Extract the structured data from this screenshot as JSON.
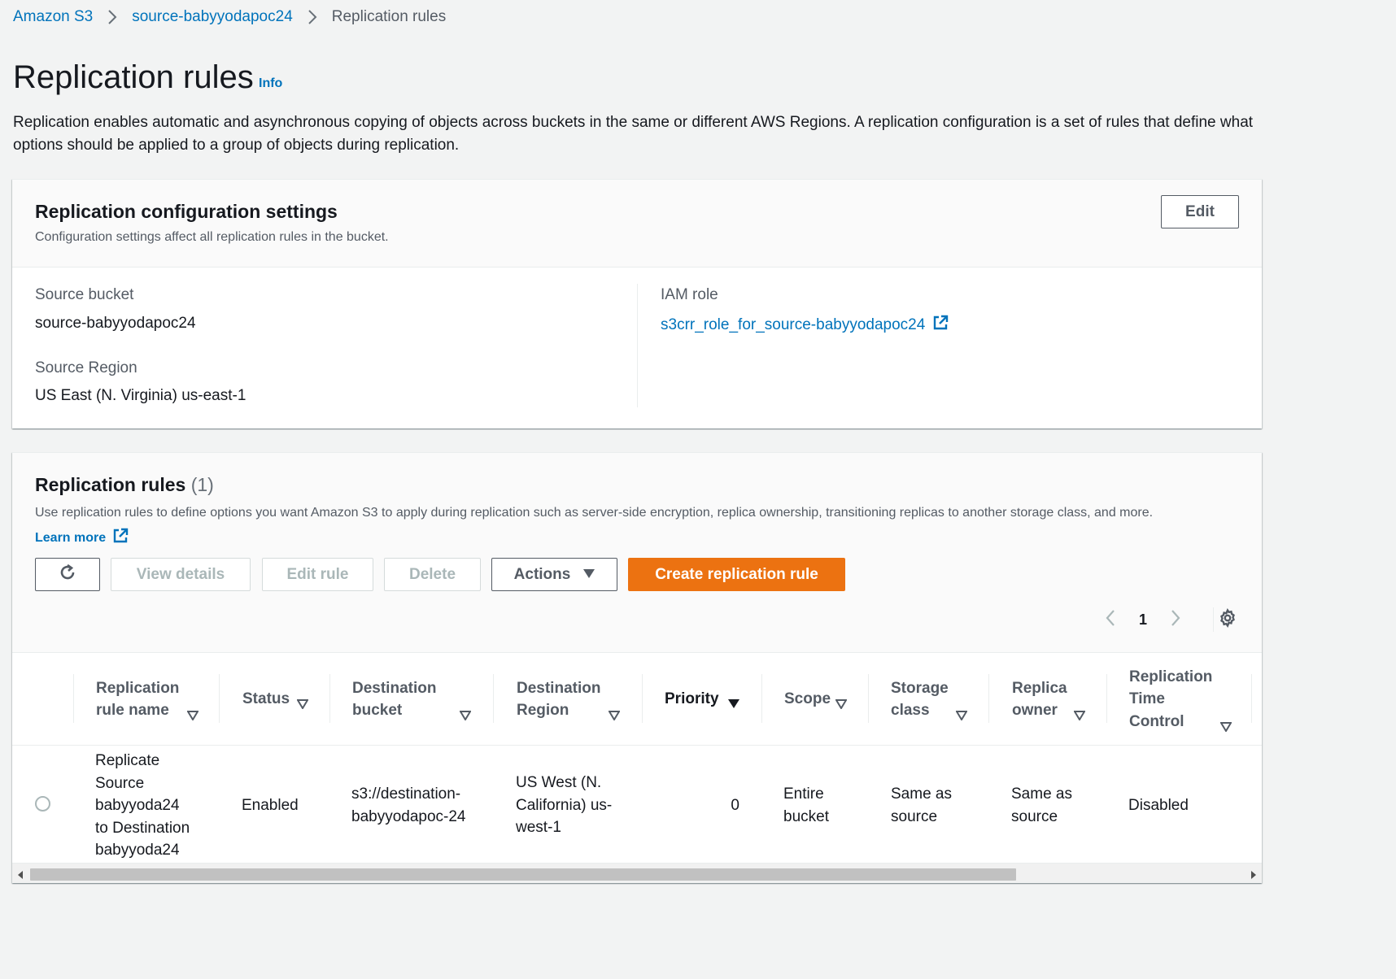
{
  "breadcrumb": {
    "items": [
      "Amazon S3",
      "source-babyyodapoc24"
    ],
    "current": "Replication rules"
  },
  "page": {
    "title": "Replication rules",
    "info": "Info",
    "description": "Replication enables automatic and asynchronous copying of objects across buckets in the same or different AWS Regions. A replication configuration is a set of rules that define what options should be applied to a group of objects during replication."
  },
  "config": {
    "title": "Replication configuration settings",
    "subtitle": "Configuration settings affect all replication rules in the bucket.",
    "edit_label": "Edit",
    "source_bucket_label": "Source bucket",
    "source_bucket_value": "source-babyyodapoc24",
    "source_region_label": "Source Region",
    "source_region_value": "US East (N. Virginia) us-east-1",
    "iam_role_label": "IAM role",
    "iam_role_value": "s3crr_role_for_source-babyyodapoc24"
  },
  "rules": {
    "title": "Replication rules",
    "count": "(1)",
    "description": "Use replication rules to define options you want Amazon S3 to apply during replication such as server-side encryption, replica ownership, transitioning replicas to another storage class, and more.",
    "learn_more": "Learn more",
    "buttons": {
      "view_details": "View details",
      "edit_rule": "Edit rule",
      "delete": "Delete",
      "actions": "Actions",
      "create": "Create replication rule"
    },
    "page_number": "1",
    "columns": {
      "name": [
        "Replication",
        "rule name"
      ],
      "status": "Status",
      "destination_bucket": [
        "Destination",
        "bucket"
      ],
      "destination_region": [
        "Destination",
        "Region"
      ],
      "priority": "Priority",
      "scope": "Scope",
      "storage_class": [
        "Storage",
        "class"
      ],
      "replica_owner": [
        "Replica",
        "owner"
      ],
      "rtc": [
        "Replication",
        "Time",
        "Control"
      ]
    },
    "rows": [
      {
        "name": [
          "Replicate",
          "Source",
          "babyyoda24",
          "to Destination",
          "babyyoda24"
        ],
        "status": "Enabled",
        "destination_bucket": [
          "s3://destination-",
          "babyyodapoc-24"
        ],
        "destination_region": [
          "US West (N.",
          "California) us-",
          "west-1"
        ],
        "priority": "0",
        "scope": [
          "Entire",
          "bucket"
        ],
        "storage_class": [
          "Same as",
          "source"
        ],
        "replica_owner": [
          "Same as",
          "source"
        ],
        "rtc": "Disabled"
      }
    ]
  },
  "colors": {
    "link": "#0073bb",
    "primary": "#ec7211",
    "text": "#16191f",
    "secondary_text": "#545b64",
    "disabled": "#aab7b8"
  },
  "icons": [
    "chevron-right-icon",
    "external-link-icon",
    "refresh-icon",
    "caret-down-icon",
    "chevron-left-icon",
    "gear-icon",
    "sort-icon"
  ]
}
